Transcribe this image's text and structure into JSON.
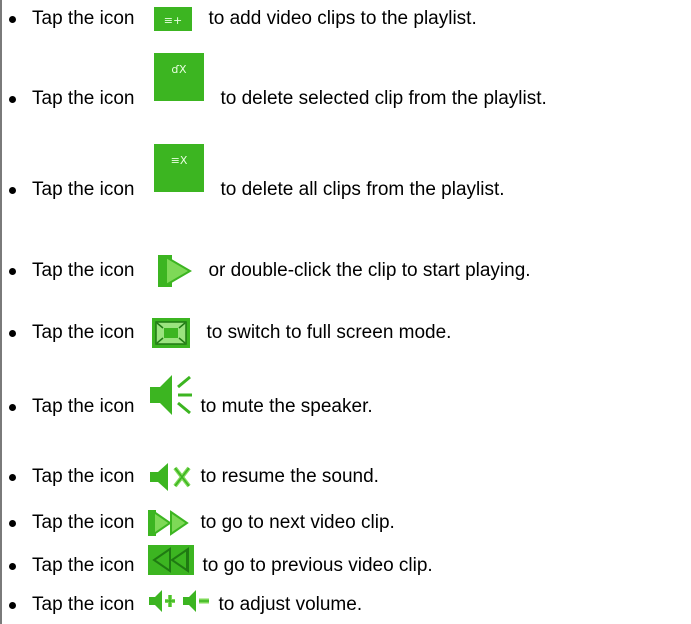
{
  "instructions": [
    {
      "lead": "Tap the icon",
      "icon": "add-clips-icon",
      "icon_glyph": "≡+",
      "text": "to add video clips to the playlist."
    },
    {
      "lead": "Tap the icon",
      "icon": "delete-clip-icon",
      "icon_glyph": "ɗX",
      "text": "to delete selected clip from the playlist."
    },
    {
      "lead": "Tap the icon",
      "icon": "delete-all-icon",
      "icon_glyph": "≡X",
      "text": "to delete all clips from the playlist."
    },
    {
      "lead": "Tap the icon",
      "icon": "play-icon",
      "text": "or double-click the clip to start playing."
    },
    {
      "lead": "Tap the icon",
      "icon": "fullscreen-icon",
      "text": "to switch to full screen mode."
    },
    {
      "lead": "Tap the icon",
      "icon": "speaker-on-icon",
      "text": "to mute the speaker."
    },
    {
      "lead": "Tap the icon",
      "icon": "speaker-muted-icon",
      "text": "to resume the sound."
    },
    {
      "lead": "Tap the icon",
      "icon": "next-clip-icon",
      "text": "to go to next video clip."
    },
    {
      "lead": "Tap the icon",
      "icon": "previous-clip-icon",
      "text": "to go to previous video clip."
    },
    {
      "lead": "Tap the icon",
      "icon": "volume-icons",
      "text": "to adjust volume."
    }
  ],
  "colors": {
    "icon_green": "#3cb521",
    "icon_green_light": "#7ed957",
    "icon_text": "#e8ffe0"
  }
}
